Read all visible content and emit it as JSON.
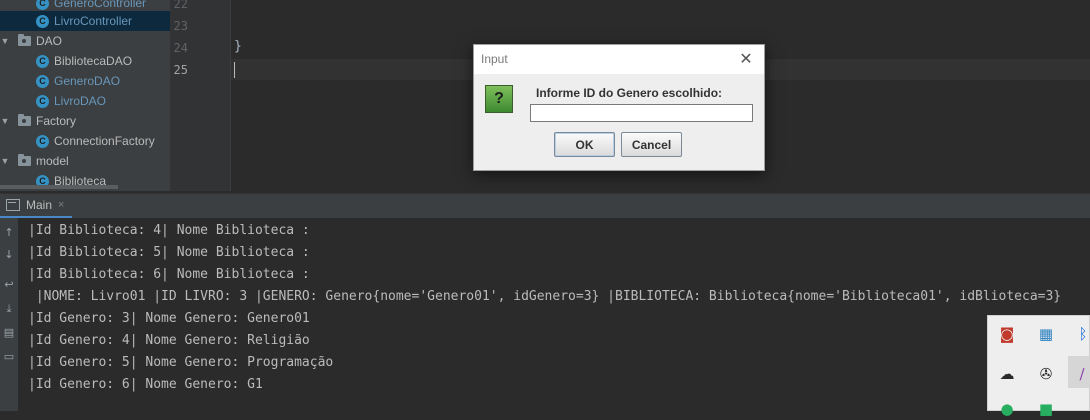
{
  "project_tree": {
    "items": [
      {
        "label": "GeneroController",
        "kind": "class",
        "modified": true,
        "selected": false,
        "icon": "class-icon"
      },
      {
        "label": "LivroController",
        "kind": "class",
        "modified": true,
        "selected": true,
        "icon": "class-icon"
      },
      {
        "label": "DAO",
        "kind": "package",
        "icon": "package-folder-icon"
      },
      {
        "label": "BibliotecaDAO",
        "kind": "class",
        "modified": false,
        "icon": "class-icon"
      },
      {
        "label": "GeneroDAO",
        "kind": "class",
        "modified": true,
        "icon": "class-icon"
      },
      {
        "label": "LivroDAO",
        "kind": "class",
        "modified": true,
        "icon": "class-icon"
      },
      {
        "label": "Factory",
        "kind": "package",
        "icon": "package-folder-icon"
      },
      {
        "label": "ConnectionFactory",
        "kind": "class",
        "modified": false,
        "icon": "class-icon"
      },
      {
        "label": "model",
        "kind": "package",
        "icon": "package-folder-icon"
      },
      {
        "label": "Biblioteca",
        "kind": "class",
        "modified": false,
        "icon": "class-icon"
      }
    ]
  },
  "editor": {
    "line_numbers": [
      "22",
      "23",
      "24",
      "25"
    ],
    "current_line": "25",
    "code_lines": [
      {
        "line": "24",
        "text": "}"
      }
    ]
  },
  "run_window": {
    "tab_label": "Main",
    "tab_close": "×",
    "console_lines": [
      "|Id Biblioteca: 4| Nome Biblioteca :",
      "|Id Biblioteca: 5| Nome Biblioteca :",
      "|Id Biblioteca: 6| Nome Biblioteca :",
      " |NOME: Livro01 |ID LIVRO: 3 |GENERO: Genero{nome='Genero01', idGenero=3} |BIBLIOTECA: Biblioteca{nome='Biblioteca01', idBlioteca=3}",
      "|Id Genero: 3| Nome Genero: Genero01",
      "|Id Genero: 4| Nome Genero: Religião",
      "|Id Genero: 5| Nome Genero: Programação",
      "|Id Genero: 6| Nome Genero: G1"
    ]
  },
  "dialog": {
    "title": "Input",
    "close_glyph": "✕",
    "icon_glyph": "?",
    "prompt": "Informe ID do Genero escolhido:",
    "input_value": "",
    "ok_label": "OK",
    "cancel_label": "Cancel"
  },
  "colors": {
    "accent": "#4a88c7",
    "selection": "#0d293e",
    "modified_file": "#6897bb"
  }
}
